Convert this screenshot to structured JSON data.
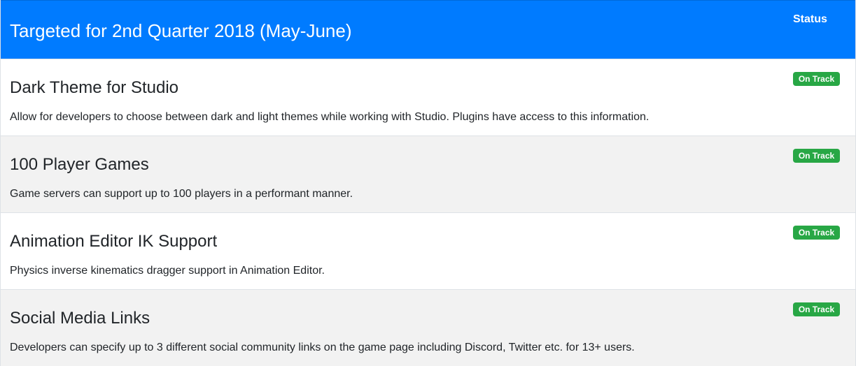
{
  "header": {
    "title": "Targeted for 2nd Quarter 2018 (May-June)",
    "status_label": "Status"
  },
  "items": [
    {
      "title": "Dark Theme for Studio",
      "description": "Allow for developers to choose between dark and light themes while working with Studio. Plugins have access to this information.",
      "status": "On Track"
    },
    {
      "title": "100 Player Games",
      "description": "Game servers can support up to 100 players in a performant manner.",
      "status": "On Track"
    },
    {
      "title": "Animation Editor IK Support",
      "description": "Physics inverse kinematics dragger support in Animation Editor.",
      "status": "On Track"
    },
    {
      "title": "Social Media Links",
      "description": "Developers can specify up to 3 different social community links on the game page including Discord, Twitter etc. for 13+ users.",
      "status": "On Track"
    }
  ],
  "colors": {
    "header_bg": "#007bff",
    "badge_bg": "#28a745",
    "alt_row_bg": "#f2f2f2"
  }
}
